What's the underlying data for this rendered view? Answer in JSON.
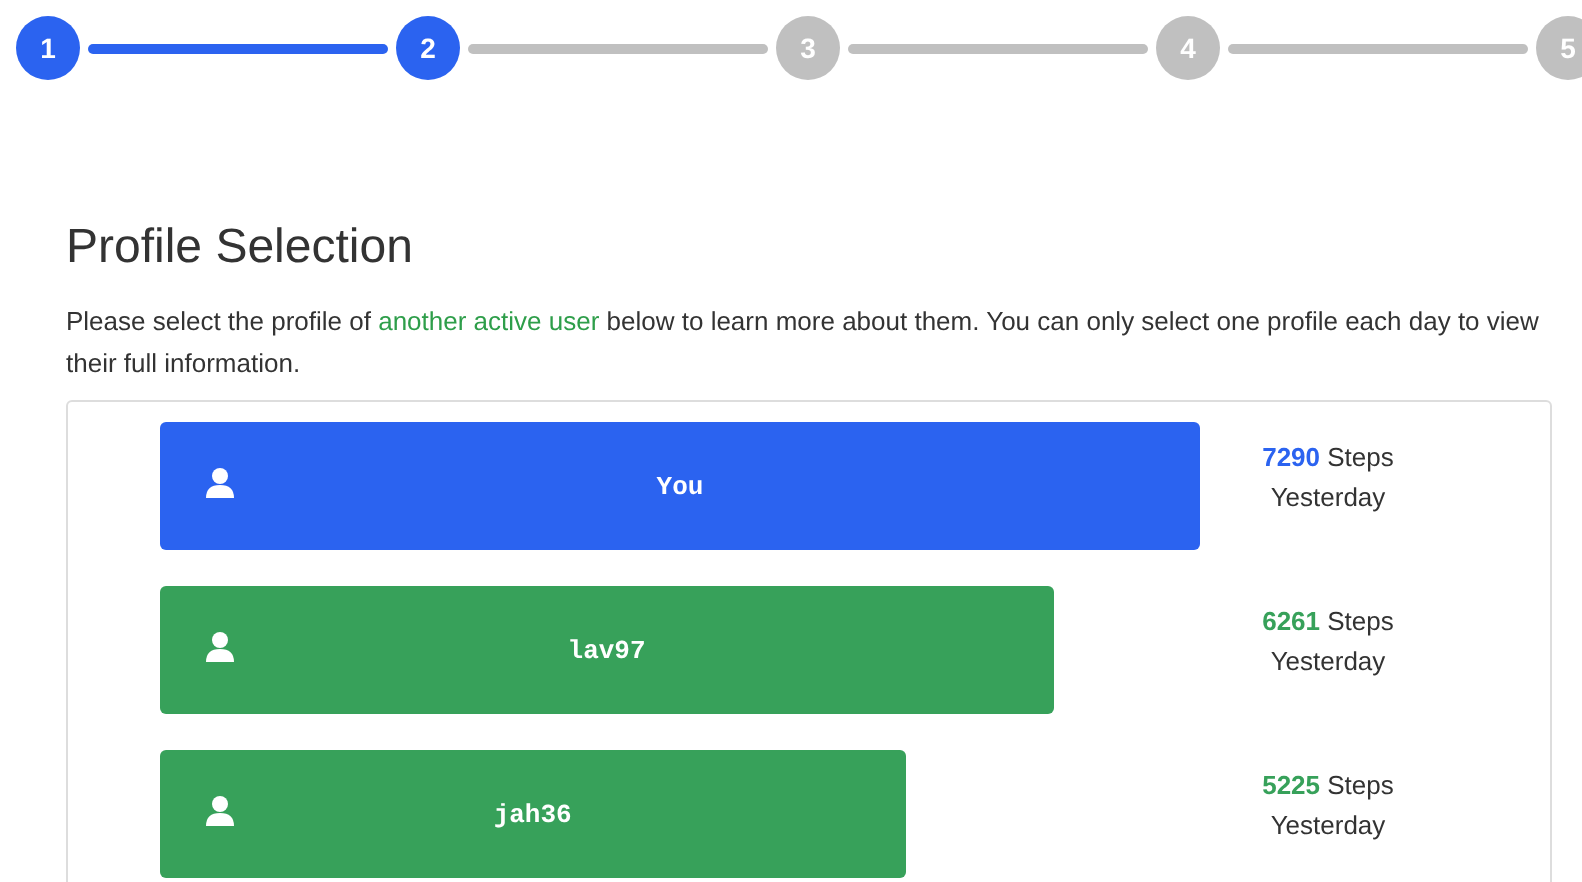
{
  "stepper": [
    {
      "label": "1",
      "done": true
    },
    {
      "label": "2",
      "done": true
    },
    {
      "label": "3",
      "done": false
    },
    {
      "label": "4",
      "done": false
    },
    {
      "label": "5",
      "done": false
    }
  ],
  "title": "Profile Selection",
  "intro": {
    "before": "Please select the profile of ",
    "link": "another active user",
    "after": " below to learn more about them. You can only select one profile each day to view their full information."
  },
  "profiles": [
    {
      "name": "You",
      "color": "#2b63f0",
      "count": "7290",
      "unit": "Steps",
      "period": "Yesterday"
    },
    {
      "name": "lav97",
      "color": "#37a15a",
      "count": "6261",
      "unit": "Steps",
      "period": "Yesterday"
    },
    {
      "name": "jah36",
      "color": "#37a15a",
      "count": "5225",
      "unit": "Steps",
      "period": "Yesterday"
    }
  ]
}
